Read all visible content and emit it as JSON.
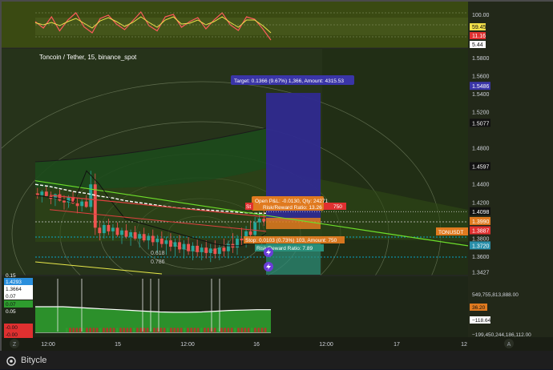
{
  "chart_title": "Toncoin / Tether, 15, binance_spot",
  "footer_label": "Bitycle",
  "colors": {
    "background": "#1e2617",
    "price_up": "#26a69a",
    "price_down": "#ef5350",
    "target_zone": "#3a2f8f",
    "stop_zone": "#e07a1f",
    "green_band": "#2f5a1f",
    "volume_green": "#2e9c2e",
    "line_white": "#ffffff",
    "line_lime": "#6dde2a"
  },
  "labels": {
    "target": "Target: 0.1366 (9.67%) 1,366, Amount: 4315.53",
    "open_pl": "Open P&L: -0.0130, Qty: 24271",
    "risk_reward_top": "Risk/Reward Ratio: 13.26",
    "stop_fragment_left": "St",
    "stop_fragment_right": "750",
    "stop_bottom": "Stop: 0.0103 (0.73%) 103, Amount: 750",
    "risk_reward_bottom": "Risk/Reward Ratio: 7.89",
    "tonusdt": "TONUSDT",
    "fib_1": "0.618",
    "fib_2": "0.786"
  },
  "oscillator_axis": [
    "100.00",
    "59.45",
    "11.16",
    "5.44"
  ],
  "price_axis": [
    "1.5800",
    "1.5600",
    "1.5486",
    "1.5400",
    "1.5200",
    "1.5077",
    "1.4800",
    "1.4597",
    "1.4400",
    "1.4200",
    "1.4098",
    "1.3990",
    "1.3887",
    "1.3800",
    "1.3720",
    "1.3600",
    "1.3427"
  ],
  "volume_axis": [
    "549,755,813,888.00",
    "36.20",
    "−118.64",
    "−199,450,244,186,112.00"
  ],
  "left_values": [
    "0.15",
    "1.4293",
    "1.3664",
    "0.07",
    "0.07",
    "0.05",
    "-0.00",
    "-0.00"
  ],
  "time_axis": [
    "12:00",
    "15",
    "12:00",
    "16",
    "12:00",
    "17",
    "12"
  ],
  "corner_letters": {
    "left": "Z",
    "right": "A"
  },
  "chart_data": [
    {
      "type": "line",
      "title": "",
      "x": [
        0,
        1,
        2,
        3,
        4,
        5,
        6,
        7,
        8,
        9,
        10,
        11,
        12,
        13,
        14,
        15,
        16,
        17,
        18,
        19,
        20,
        21,
        22,
        23,
        24,
        25,
        26,
        27,
        28,
        29
      ],
      "series": [
        {
          "values": [
            58,
            42,
            70,
            35,
            62,
            80,
            45,
            30,
            66,
            74,
            52,
            38,
            60,
            82,
            48,
            35,
            70,
            76,
            44,
            58,
            68,
            40,
            62,
            80,
            50,
            36,
            70,
            64,
            40,
            12
          ]
        },
        {
          "values": [
            55,
            50,
            56,
            48,
            58,
            66,
            54,
            42,
            60,
            68,
            58,
            46,
            56,
            70,
            56,
            44,
            62,
            70,
            52,
            54,
            62,
            50,
            58,
            70,
            56,
            44,
            62,
            62,
            48,
            30
          ]
        }
      ],
      "ylim": [
        0,
        100
      ]
    },
    {
      "type": "candlestick",
      "title": "Toncoin / Tether, 15, binance_spot",
      "ylim": [
        1.34,
        1.59
      ],
      "candles": [
        [
          1.43,
          1.436,
          1.424,
          1.428
        ],
        [
          1.428,
          1.434,
          1.42,
          1.432
        ],
        [
          1.432,
          1.438,
          1.426,
          1.427
        ],
        [
          1.427,
          1.432,
          1.418,
          1.424
        ],
        [
          1.424,
          1.43,
          1.416,
          1.429
        ],
        [
          1.429,
          1.434,
          1.421,
          1.422
        ],
        [
          1.422,
          1.428,
          1.412,
          1.42
        ],
        [
          1.42,
          1.428,
          1.414,
          1.426
        ],
        [
          1.426,
          1.432,
          1.418,
          1.419
        ],
        [
          1.419,
          1.425,
          1.408,
          1.416
        ],
        [
          1.416,
          1.424,
          1.41,
          1.421
        ],
        [
          1.421,
          1.428,
          1.414,
          1.415
        ],
        [
          1.415,
          1.455,
          1.41,
          1.44
        ],
        [
          1.44,
          1.452,
          1.384,
          1.392
        ],
        [
          1.392,
          1.4,
          1.378,
          1.386
        ],
        [
          1.386,
          1.398,
          1.38,
          1.395
        ],
        [
          1.395,
          1.402,
          1.384,
          1.388
        ],
        [
          1.388,
          1.396,
          1.378,
          1.392
        ],
        [
          1.392,
          1.398,
          1.382,
          1.384
        ],
        [
          1.384,
          1.392,
          1.374,
          1.389
        ],
        [
          1.389,
          1.396,
          1.38,
          1.382
        ],
        [
          1.382,
          1.39,
          1.372,
          1.387
        ],
        [
          1.387,
          1.394,
          1.378,
          1.38
        ],
        [
          1.38,
          1.388,
          1.37,
          1.385
        ],
        [
          1.385,
          1.392,
          1.376,
          1.378
        ],
        [
          1.378,
          1.386,
          1.368,
          1.383
        ],
        [
          1.383,
          1.39,
          1.372,
          1.376
        ],
        [
          1.376,
          1.384,
          1.364,
          1.38
        ],
        [
          1.38,
          1.388,
          1.37,
          1.374
        ],
        [
          1.374,
          1.382,
          1.362,
          1.378
        ],
        [
          1.378,
          1.386,
          1.366,
          1.371
        ],
        [
          1.371,
          1.38,
          1.36,
          1.376
        ],
        [
          1.376,
          1.384,
          1.364,
          1.368
        ],
        [
          1.368,
          1.378,
          1.358,
          1.374
        ],
        [
          1.374,
          1.382,
          1.362,
          1.366
        ],
        [
          1.366,
          1.376,
          1.356,
          1.372
        ],
        [
          1.372,
          1.38,
          1.36,
          1.365
        ],
        [
          1.365,
          1.374,
          1.356,
          1.37
        ],
        [
          1.37,
          1.378,
          1.358,
          1.364
        ],
        [
          1.364,
          1.374,
          1.354,
          1.369
        ],
        [
          1.369,
          1.378,
          1.358,
          1.363
        ],
        [
          1.363,
          1.374,
          1.356,
          1.37
        ],
        [
          1.37,
          1.38,
          1.36,
          1.366
        ],
        [
          1.366,
          1.378,
          1.358,
          1.374
        ],
        [
          1.374,
          1.386,
          1.364,
          1.37
        ],
        [
          1.37,
          1.384,
          1.362,
          1.38
        ],
        [
          1.38,
          1.392,
          1.372,
          1.378
        ],
        [
          1.378,
          1.394,
          1.37,
          1.388
        ],
        [
          1.388,
          1.4,
          1.38,
          1.384
        ],
        [
          1.384,
          1.404,
          1.378,
          1.398
        ],
        [
          1.398,
          1.41,
          1.39,
          1.402
        ],
        [
          1.402,
          1.414,
          1.394,
          1.399
        ]
      ],
      "lines": {
        "white_dashed": [
          1.44,
          1.438,
          1.435,
          1.432,
          1.43,
          1.427,
          1.425,
          1.422,
          1.42,
          1.418,
          1.416,
          1.414,
          1.413,
          1.412,
          1.411,
          1.41,
          1.409,
          1.408,
          1.408
        ],
        "lime_trend": [
          1.444,
          1.44,
          1.436,
          1.432,
          1.428,
          1.424,
          1.42,
          1.416,
          1.412,
          1.408,
          1.404,
          1.4,
          1.396,
          1.392,
          1.388,
          1.384,
          1.38,
          1.376,
          1.372
        ],
        "black_line": [
          1.428,
          1.426,
          1.424,
          1.42,
          1.455,
          1.44,
          1.42,
          1.402,
          1.398,
          1.394,
          1.39,
          1.386,
          1.382,
          1.378,
          1.374,
          1.372,
          1.372,
          1.376,
          1.386
        ]
      },
      "position": {
        "entry": 1.399,
        "target": 1.5486,
        "stop": 1.3887,
        "current": 1.4098
      }
    },
    {
      "type": "area",
      "title": "",
      "values": [
        0.07,
        0.07,
        0.07,
        0.068,
        0.066,
        0.064,
        0.062,
        0.06,
        0.058,
        0.056,
        0.055,
        0.055,
        0.056,
        0.058,
        0.06,
        0.061,
        0.062,
        0.062
      ],
      "ylim": [
        -0.01,
        0.15
      ]
    }
  ]
}
